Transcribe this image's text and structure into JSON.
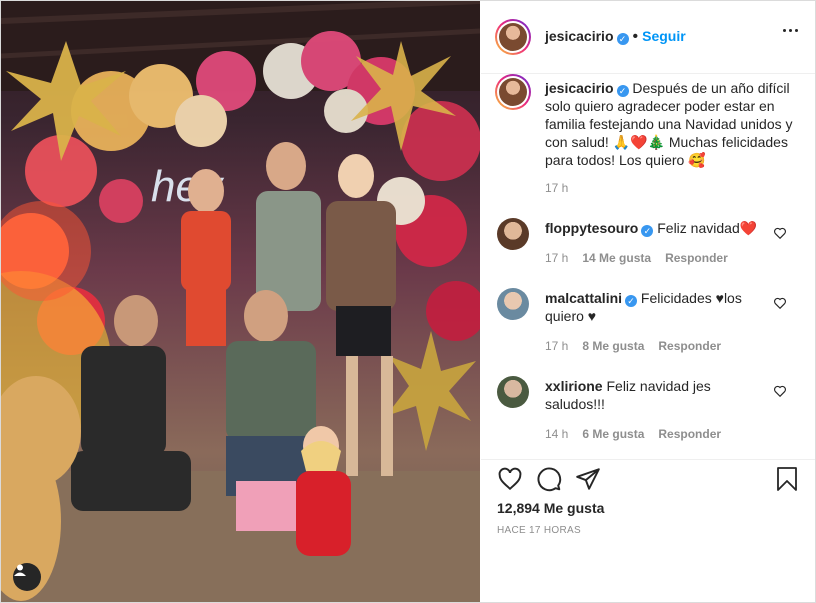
{
  "post": {
    "author": "jesicacirio",
    "follow_label": "Seguir",
    "caption": "Después de un año difícil solo quiero agradecer poder estar en familia festejando una Navidad unidos y con salud! 🙏❤️🎄 Muchas felicidades para todos! Los quiero 🥰",
    "caption_time": "17 h",
    "likes": "12,894 Me gusta",
    "posted_ago": "HACE 17 HORAS"
  },
  "comments": [
    {
      "user": "floppytesouro",
      "text": "Feliz navidad❤️",
      "time": "17 h",
      "likes": "14 Me gusta",
      "reply": "Responder"
    },
    {
      "user": "malcattalini",
      "text": "Felicidades ♥los quiero ♥",
      "time": "17 h",
      "likes": "8 Me gusta",
      "reply": "Responder"
    },
    {
      "user": "xxlirione",
      "text": "Feliz navidad jes saludos!!!",
      "time": "14 h",
      "likes": "6 Me gusta",
      "reply": "Responder"
    }
  ],
  "icons": {
    "verified": "verified-badge-icon",
    "more": "more-options-icon",
    "like": "heart-icon",
    "comment": "comment-icon",
    "share": "paper-plane-icon",
    "save": "bookmark-icon",
    "user_tag": "user-tag-icon"
  },
  "colors": {
    "accent": "#0095f6",
    "verified": "#3897f0",
    "muted": "#8e8e8e"
  }
}
